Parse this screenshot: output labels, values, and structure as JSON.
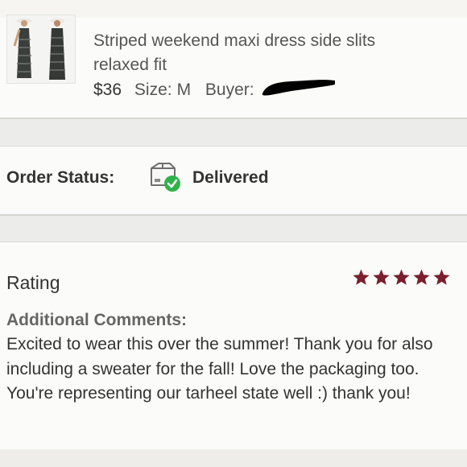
{
  "item": {
    "title": "Striped weekend maxi dress side slits relaxed fit",
    "price": "$36",
    "size_label": "Size:",
    "size_value": "M",
    "buyer_label": "Buyer:"
  },
  "order_status": {
    "label": "Order Status:",
    "value": "Delivered",
    "icon": "package-delivered-icon"
  },
  "rating": {
    "title": "Rating",
    "stars": 5,
    "max_stars": 5,
    "star_color": "#7a1f2b"
  },
  "comments": {
    "label": "Additional Comments:",
    "text": "Excited to wear this over the summer! Thank you for also including a sweater for the fall! Love the packaging too. You're representing our tarheel state well :) thank you!"
  }
}
